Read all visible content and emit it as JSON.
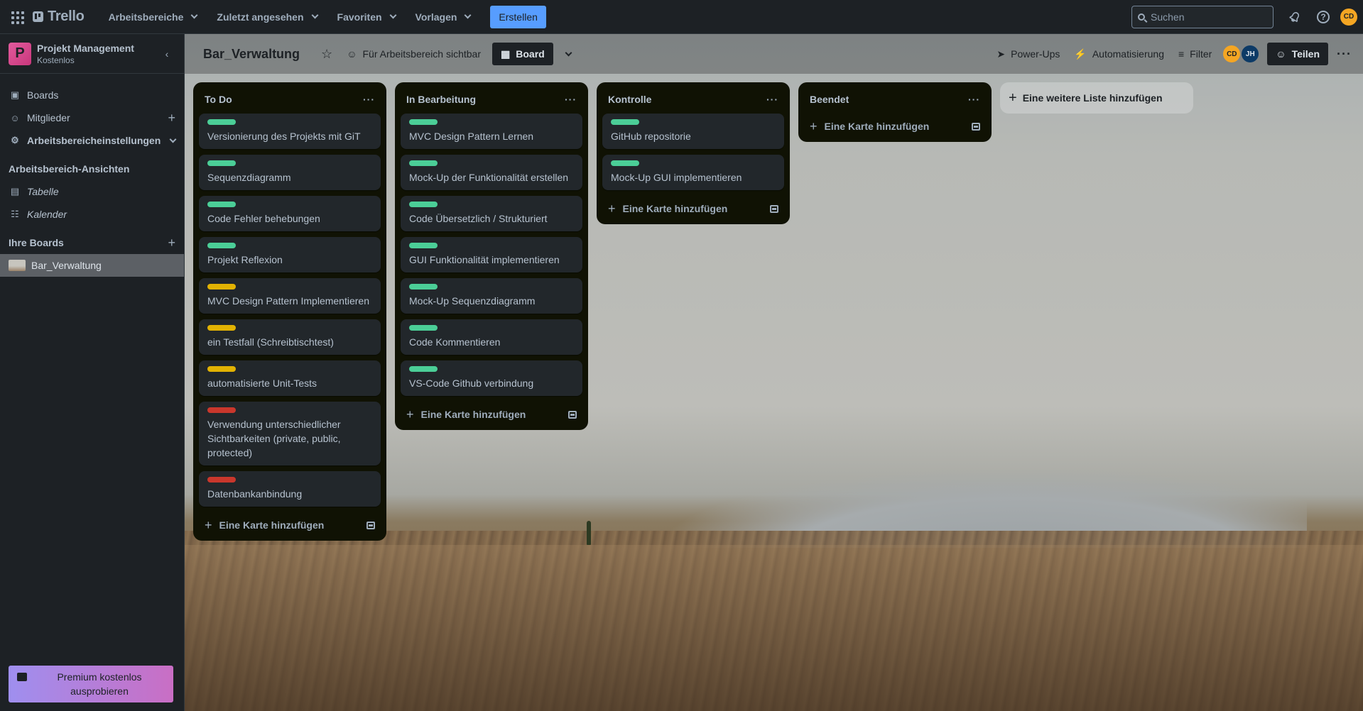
{
  "header": {
    "logo_text": "Trello",
    "nav": [
      {
        "label": "Arbeitsbereiche"
      },
      {
        "label": "Zuletzt angesehen"
      },
      {
        "label": "Favoriten"
      },
      {
        "label": "Vorlagen"
      }
    ],
    "create_label": "Erstellen",
    "search_placeholder": "Suchen",
    "avatar_initials": "CD"
  },
  "sidebar": {
    "workspace_initial": "P",
    "workspace_name": "Projekt Management",
    "workspace_plan": "Kostenlos",
    "items": [
      {
        "label": "Boards",
        "icon": "trello-board-icon"
      },
      {
        "label": "Mitglieder",
        "icon": "person-icon"
      },
      {
        "label": "Arbeitsbereicheinstellungen",
        "icon": "gear-icon"
      }
    ],
    "views_heading": "Arbeitsbereich-Ansichten",
    "views": [
      {
        "label": "Tabelle",
        "icon": "table-icon"
      },
      {
        "label": "Kalender",
        "icon": "calendar-icon"
      }
    ],
    "boards_heading": "Ihre Boards",
    "boards": [
      {
        "label": "Bar_Verwaltung"
      }
    ],
    "premium_label": "Premium kostenlos ausprobieren"
  },
  "board": {
    "title": "Bar_Verwaltung",
    "visibility_label": "Für Arbeitsbereich sichtbar",
    "view_label": "Board",
    "powerups_label": "Power-Ups",
    "automation_label": "Automatisierung",
    "filter_label": "Filter",
    "members": [
      "CD",
      "JH"
    ],
    "share_label": "Teilen",
    "add_card_label": "Eine Karte hinzufügen",
    "add_list_label": "Eine weitere Liste hinzufügen"
  },
  "colors": {
    "green": "#4bce97",
    "yellow": "#e2b203",
    "red": "#c9372c"
  },
  "lists": [
    {
      "title": "To Do",
      "cards": [
        {
          "label_color": "green",
          "text": "Versionierung des Projekts mit GiT"
        },
        {
          "label_color": "green",
          "text": "Sequenzdiagramm"
        },
        {
          "label_color": "green",
          "text": "Code Fehler behebungen"
        },
        {
          "label_color": "green",
          "text": "Projekt Reflexion"
        },
        {
          "label_color": "yellow",
          "text": "MVC Design Pattern Implementieren"
        },
        {
          "label_color": "yellow",
          "text": "ein Testfall (Schreibtischtest)"
        },
        {
          "label_color": "yellow",
          "text": "automatisierte Unit-Tests"
        },
        {
          "label_color": "red",
          "text": "Verwendung unterschiedlicher Sichtbarkeiten (private, public, protected)"
        },
        {
          "label_color": "red",
          "text": "Datenbankanbindung"
        }
      ]
    },
    {
      "title": "In Bearbeitung",
      "cards": [
        {
          "label_color": "green",
          "text": "MVC Design Pattern Lernen"
        },
        {
          "label_color": "green",
          "text": "Mock-Up der Funktionalität erstellen"
        },
        {
          "label_color": "green",
          "text": "Code Übersetzlich / Strukturiert"
        },
        {
          "label_color": "green",
          "text": "GUI Funktionalität implementieren"
        },
        {
          "label_color": "green",
          "text": "Mock-Up Sequenzdiagramm"
        },
        {
          "label_color": "green",
          "text": "Code Kommentieren"
        },
        {
          "label_color": "green",
          "text": "VS-Code Github verbindung"
        }
      ]
    },
    {
      "title": "Kontrolle",
      "cards": [
        {
          "label_color": "green",
          "text": "GitHub repositorie"
        },
        {
          "label_color": "green",
          "text": "Mock-Up GUI implementieren"
        }
      ]
    },
    {
      "title": "Beendet",
      "cards": []
    }
  ]
}
